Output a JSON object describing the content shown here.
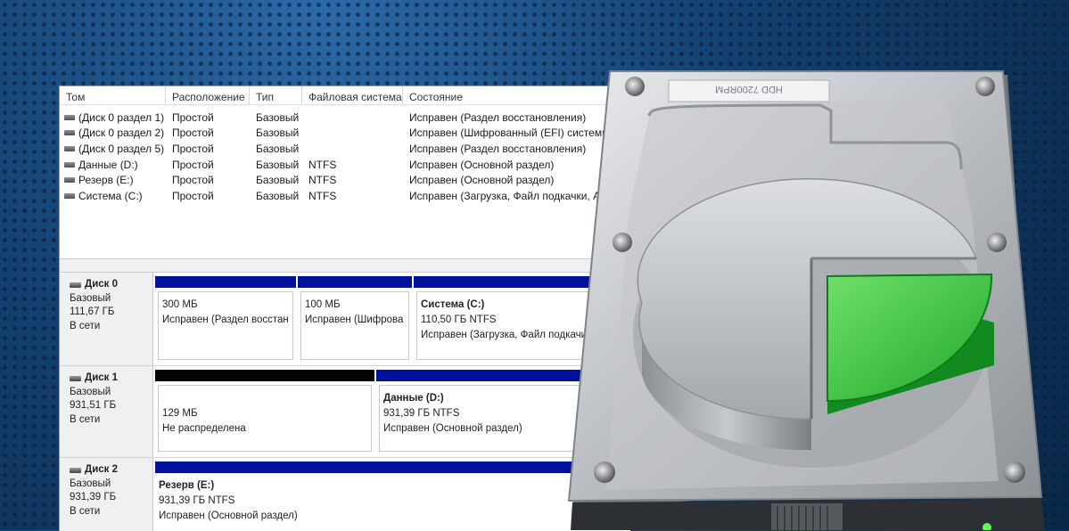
{
  "window": {
    "columns": [
      "Том",
      "Расположение",
      "Тип",
      "Файловая система",
      "Состояние"
    ],
    "volumes": [
      {
        "name": "(Диск 0 раздел 1)",
        "layout": "Простой",
        "type": "Базовый",
        "fs": "",
        "status": "Исправен (Раздел восстановления)"
      },
      {
        "name": "(Диск 0 раздел 2)",
        "layout": "Простой",
        "type": "Базовый",
        "fs": "",
        "status": "Исправен (Шифрованный (EFI) системн"
      },
      {
        "name": "(Диск 0 раздел 5)",
        "layout": "Простой",
        "type": "Базовый",
        "fs": "",
        "status": "Исправен (Раздел восстановления)"
      },
      {
        "name": "Данные (D:)",
        "layout": "Простой",
        "type": "Базовый",
        "fs": "NTFS",
        "status": "Исправен (Основной раздел)"
      },
      {
        "name": "Резерв (E:)",
        "layout": "Простой",
        "type": "Базовый",
        "fs": "NTFS",
        "status": "Исправен (Основной раздел)"
      },
      {
        "name": "Система (C:)",
        "layout": "Простой",
        "type": "Базовый",
        "fs": "NTFS",
        "status": "Исправен (Загрузка, Файл подкачки, А"
      }
    ],
    "disks": [
      {
        "title": "Диск 0",
        "kind": "Базовый",
        "size": "111,67 ГБ",
        "state": "В сети",
        "partitions": [
          {
            "name": "",
            "size": "300 МБ",
            "status": "Исправен (Раздел восстан"
          },
          {
            "name": "",
            "size": "100 МБ",
            "status": "Исправен (Шифрова"
          },
          {
            "name": "Система  (C:)",
            "size": "110,50 ГБ NTFS",
            "status": "Исправен (Загрузка, Файл подкачи"
          }
        ]
      },
      {
        "title": "Диск 1",
        "kind": "Базовый",
        "size": "931,51 ГБ",
        "state": "В сети",
        "partitions": [
          {
            "name": "",
            "size": "129 МБ",
            "status": "Не распределена"
          },
          {
            "name": "Данные  (D:)",
            "size": "931,39 ГБ NTFS",
            "status": "Исправен (Основной раздел)"
          }
        ]
      },
      {
        "title": "Диск 2",
        "kind": "Базовый",
        "size": "931,39 ГБ",
        "state": "В сети",
        "partitions": [
          {
            "name": "Резерв  (E:)",
            "size": "931,39 ГБ NTFS",
            "status": "Исправен (Основной раздел)"
          }
        ]
      }
    ]
  },
  "hdd": {
    "label": "HDD 7200RPM",
    "icon": "hard-drive-pie-chart-icon",
    "accent_color": "#2fb33a"
  }
}
